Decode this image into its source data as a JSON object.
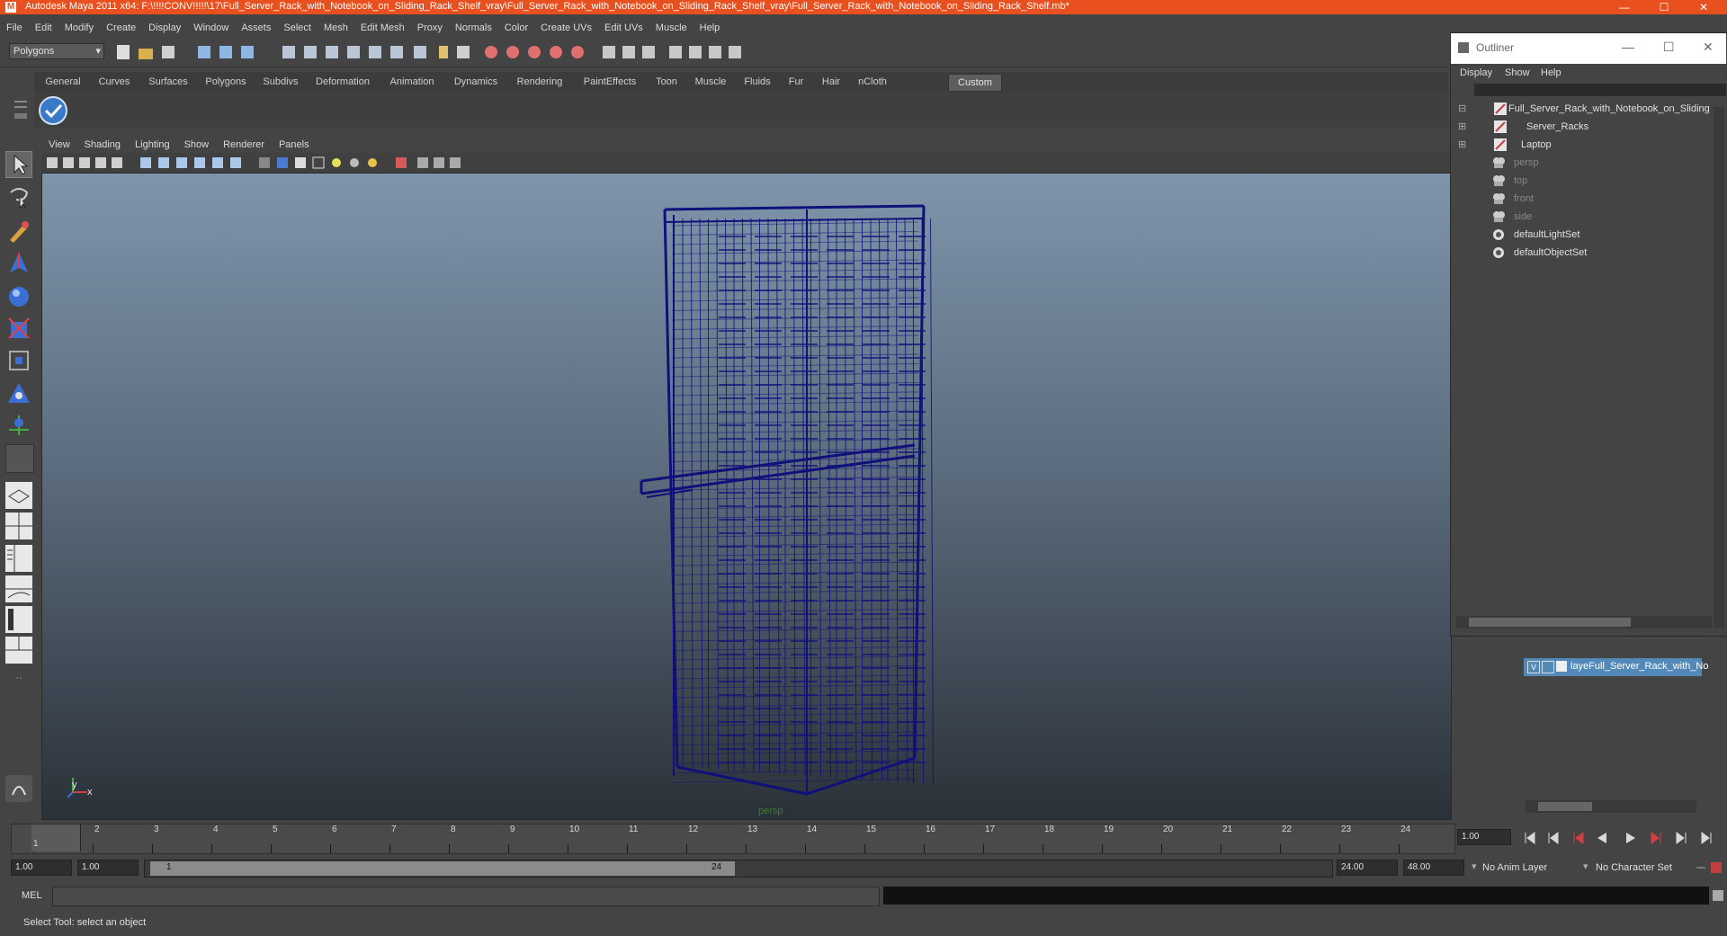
{
  "window": {
    "title": "Autodesk Maya 2011 x64: F:\\!!!!CONV!!!!!\\17\\Full_Server_Rack_with_Notebook_on_Sliding_Rack_Shelf_vray\\Full_Server_Rack_with_Notebook_on_Sliding_Rack_Shelf_vray\\Full_Server_Rack_with_Notebook_on_Sliding_Rack_Shelf.mb*",
    "minimize": "—",
    "maximize": "☐",
    "close": "✕"
  },
  "menubar": [
    "File",
    "Edit",
    "Modify",
    "Create",
    "Display",
    "Window",
    "Assets",
    "Select",
    "Mesh",
    "Edit Mesh",
    "Proxy",
    "Normals",
    "Color",
    "Create UVs",
    "Edit UVs",
    "Muscle",
    "Help"
  ],
  "statusline": {
    "mode": "Polygons"
  },
  "shelf": {
    "tabs": [
      "General",
      "Curves",
      "Surfaces",
      "Polygons",
      "Subdivs",
      "Deformation",
      "Animation",
      "Dynamics",
      "Rendering",
      "PaintEffects",
      "Toon",
      "Muscle",
      "Fluids",
      "Fur",
      "Hair",
      "nCloth",
      "Custom"
    ],
    "active": "Custom"
  },
  "panel": {
    "menus": [
      "View",
      "Shading",
      "Lighting",
      "Show",
      "Renderer",
      "Panels"
    ],
    "camera_label": "persp",
    "axis_y": "y",
    "axis_x": "x"
  },
  "timeline": {
    "ticks": [
      "1",
      "2",
      "3",
      "4",
      "5",
      "6",
      "7",
      "8",
      "9",
      "10",
      "11",
      "12",
      "13",
      "14",
      "15",
      "16",
      "17",
      "18",
      "19",
      "20",
      "21",
      "22",
      "23",
      "24"
    ],
    "current_frame_field": "1",
    "current_time": "1.00"
  },
  "range": {
    "start": "1.00",
    "inner_start": "1.00",
    "slider_start": "1",
    "slider_end": "24",
    "playback_end": "24.00",
    "end": "48.00",
    "anim_layer": "No Anim Layer",
    "character_set": "No Character Set"
  },
  "command": {
    "label": "MEL",
    "help": "Select Tool: select an object"
  },
  "outliner": {
    "title": "Outliner",
    "menus": [
      "Display",
      "Show",
      "Help"
    ],
    "items": [
      {
        "label": "Full_Server_Rack_with_Notebook_on_Sliding",
        "expander": "⊟",
        "type": "mesh",
        "dim": false
      },
      {
        "label": "Server_Racks",
        "expander": "⊞",
        "type": "mesh",
        "dim": false
      },
      {
        "label": "Laptop",
        "expander": "⊞",
        "type": "mesh",
        "dim": false
      },
      {
        "label": "persp",
        "expander": "",
        "type": "camera",
        "dim": true
      },
      {
        "label": "top",
        "expander": "",
        "type": "camera",
        "dim": true
      },
      {
        "label": "front",
        "expander": "",
        "type": "camera",
        "dim": true
      },
      {
        "label": "side",
        "expander": "",
        "type": "camera",
        "dim": true
      },
      {
        "label": "defaultLightSet",
        "expander": "",
        "type": "set",
        "dim": false
      },
      {
        "label": "defaultObjectSet",
        "expander": "",
        "type": "set",
        "dim": false
      }
    ]
  },
  "layers": {
    "layer_name": "layeFull_Server_Rack_with_No",
    "visible": "V"
  },
  "colors": {
    "title_bar": "#e8501f",
    "wireframe": "#10107a",
    "selection": "#5389b8"
  }
}
